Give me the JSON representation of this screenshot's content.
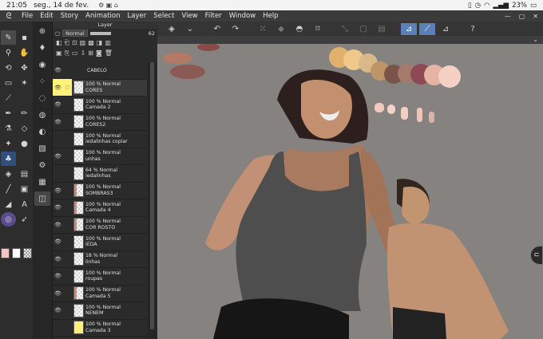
{
  "status": {
    "time": "21:05",
    "date": "seg., 14 de fev.",
    "battery": "23%"
  },
  "menu": [
    "File",
    "Edit",
    "Story",
    "Animation",
    "Layer",
    "Select",
    "View",
    "Filter",
    "Window",
    "Help"
  ],
  "layer_panel": {
    "title": "Layer",
    "blend_mode": "Normal",
    "opacity": "62",
    "layers": [
      {
        "name": "CABELO",
        "info": "",
        "visible": true,
        "selected": false,
        "thumb": "none"
      },
      {
        "name": "CORES",
        "info": "100 % Normal",
        "visible": true,
        "selected": true,
        "thumb": "check"
      },
      {
        "name": "Camada 2",
        "info": "100 % Normal",
        "visible": true,
        "selected": false,
        "thumb": "check"
      },
      {
        "name": "CORES2",
        "info": "100 % Normal",
        "visible": true,
        "selected": false,
        "thumb": "check"
      },
      {
        "name": "iedalinhas copiar",
        "info": "100 % Normal",
        "visible": false,
        "selected": false,
        "thumb": "check"
      },
      {
        "name": "unhas",
        "info": "100 % Normal",
        "visible": true,
        "selected": false,
        "thumb": "check"
      },
      {
        "name": "iedalinhas",
        "info": "64 % Normal",
        "visible": false,
        "selected": false,
        "thumb": "check"
      },
      {
        "name": "SOMBRAS3",
        "info": "100 % Normal",
        "visible": true,
        "selected": false,
        "thumb": "red"
      },
      {
        "name": "Camada 4",
        "info": "100 % Normal",
        "visible": true,
        "selected": false,
        "thumb": "red"
      },
      {
        "name": "COR ROSTO",
        "info": "100 % Normal",
        "visible": true,
        "selected": false,
        "thumb": "red"
      },
      {
        "name": "IEDA",
        "info": "100 % Normal",
        "visible": true,
        "selected": false,
        "thumb": "check"
      },
      {
        "name": "linhas",
        "info": "18 % Normal",
        "visible": true,
        "selected": false,
        "thumb": "check"
      },
      {
        "name": "roupas",
        "info": "100 % Normal",
        "visible": true,
        "selected": false,
        "thumb": "check"
      },
      {
        "name": "Camada 5",
        "info": "100 % Normal",
        "visible": true,
        "selected": false,
        "thumb": "red"
      },
      {
        "name": "NENEM",
        "info": "100 % Normal",
        "visible": true,
        "selected": false,
        "thumb": "check"
      },
      {
        "name": "Camada 3",
        "info": "100 % Normal",
        "visible": false,
        "selected": false,
        "thumb": "yellow"
      }
    ]
  },
  "colors": {
    "canvas_bg": "#858280",
    "accent": "#5b7fb8",
    "highlight": "#fff27a",
    "main_color": "#f4c6c1",
    "sub_color": "#ffffff"
  }
}
